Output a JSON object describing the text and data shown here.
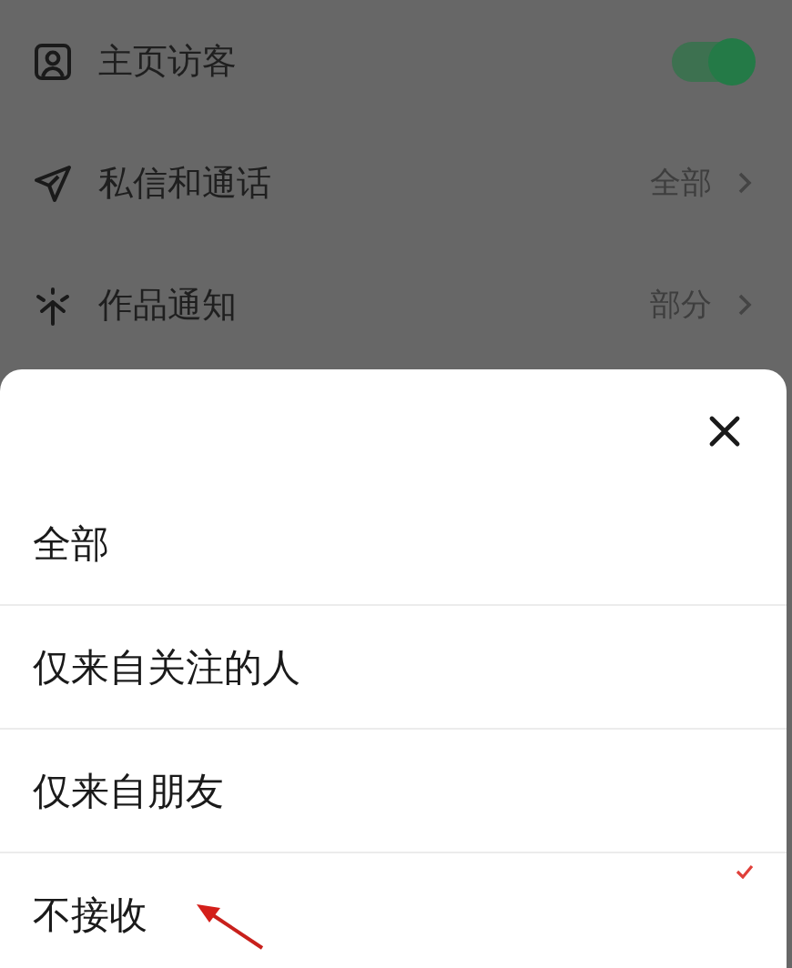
{
  "settings": [
    {
      "kind": "toggle",
      "label": "主页访客",
      "on": true
    },
    {
      "kind": "value",
      "label": "私信和通话",
      "value": "全部"
    },
    {
      "kind": "value",
      "label": "作品通知",
      "value": "部分"
    }
  ],
  "sheet": {
    "options": [
      {
        "label": "全部",
        "selected": false
      },
      {
        "label": "仅来自关注的人",
        "selected": false
      },
      {
        "label": "仅来自朋友",
        "selected": false
      },
      {
        "label": "不接收",
        "selected": true,
        "annotated": true
      }
    ]
  }
}
